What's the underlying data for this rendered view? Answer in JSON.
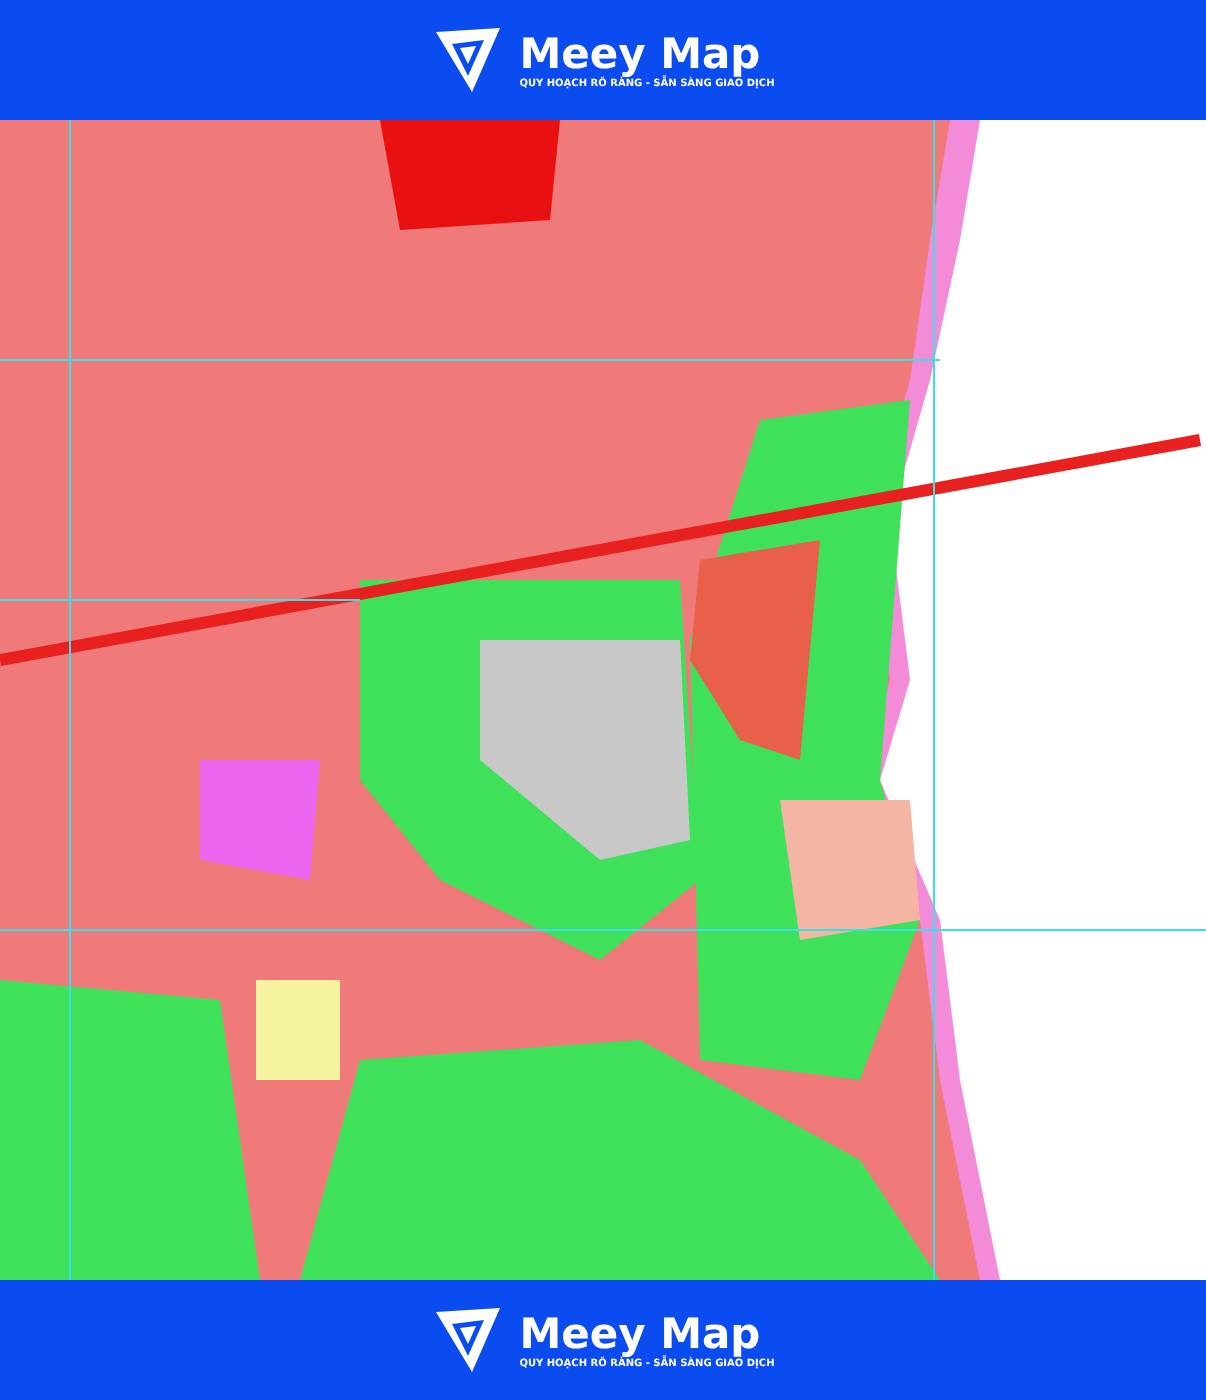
{
  "header": {
    "brand": "Meey Map",
    "tagline": "QUY HOẠCH RÕ RÀNG - SẴN SÀNG GIAO DỊCH"
  },
  "footer": {
    "brand": "Meey Map",
    "tagline": "QUY HOẠCH RÕ RÀNG - SẴN SÀNG GIAO DỊCH"
  }
}
